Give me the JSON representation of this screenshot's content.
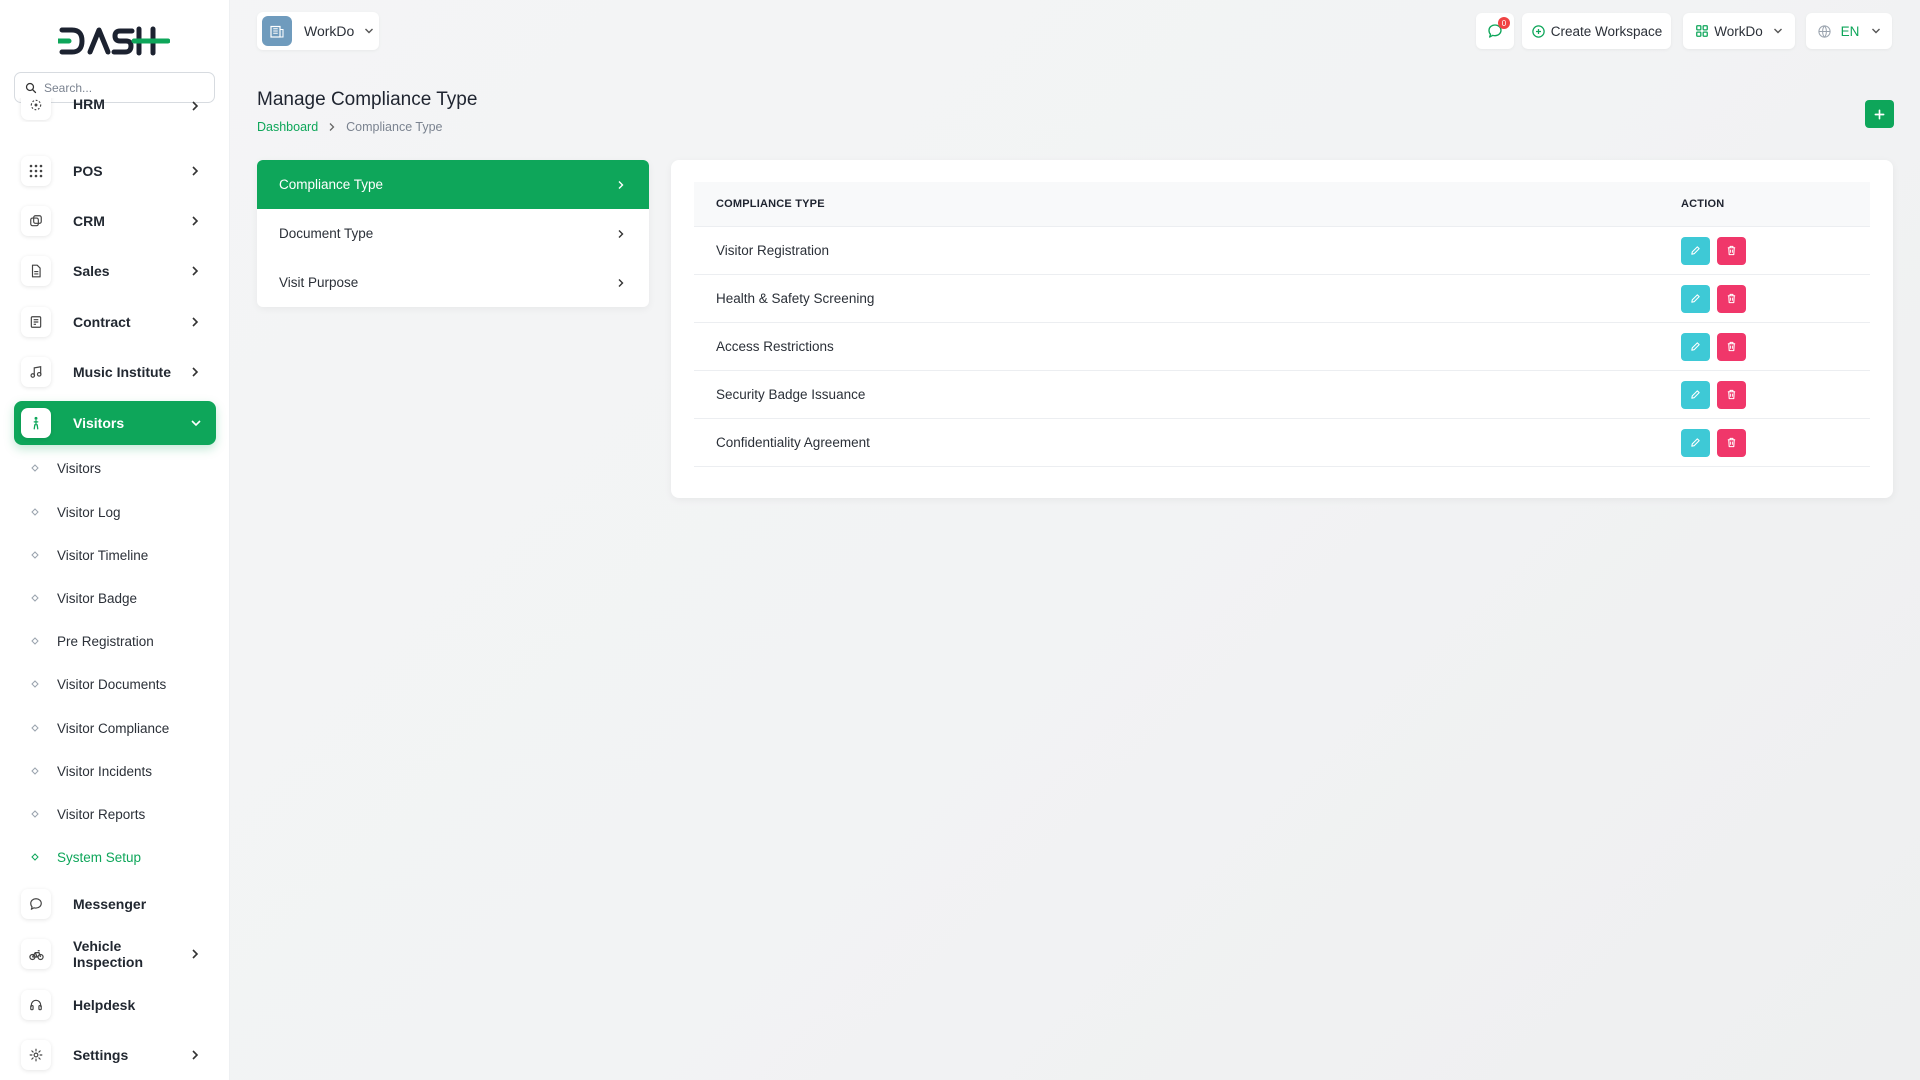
{
  "sidebar": {
    "search_placeholder": "Search...",
    "items": [
      {
        "label": "HRM",
        "icon": "hrm-icon"
      },
      {
        "label": "POS",
        "icon": "grid-icon"
      },
      {
        "label": "CRM",
        "icon": "crm-icon"
      },
      {
        "label": "Sales",
        "icon": "file-icon"
      },
      {
        "label": "Contract",
        "icon": "contract-icon"
      },
      {
        "label": "Music Institute",
        "icon": "music-icon"
      },
      {
        "label": "Visitors",
        "icon": "visitor-icon"
      },
      {
        "label": "Messenger",
        "icon": "message-icon"
      },
      {
        "label": "Vehicle Inspection",
        "icon": "bike-icon"
      },
      {
        "label": "Helpdesk",
        "icon": "headset-icon"
      },
      {
        "label": "Settings",
        "icon": "gear-icon"
      }
    ],
    "visitors_sub": [
      "Visitors",
      "Visitor Log",
      "Visitor Timeline",
      "Visitor Badge",
      "Pre Registration",
      "Visitor Documents",
      "Visitor Compliance",
      "Visitor Incidents",
      "Visitor Reports",
      "System Setup"
    ]
  },
  "topbar": {
    "workspace_name": "WorkDo",
    "notification_count": "0",
    "create_workspace_label": "Create Workspace",
    "user_workspace_label": "WorkDo",
    "language": "EN"
  },
  "page": {
    "title": "Manage Compliance Type",
    "breadcrumb_home": "Dashboard",
    "breadcrumb_current": "Compliance Type"
  },
  "setup_menu": [
    "Compliance Type",
    "Document Type",
    "Visit Purpose"
  ],
  "table": {
    "headers": {
      "type": "COMPLIANCE TYPE",
      "action": "ACTION"
    },
    "rows": [
      "Visitor Registration",
      "Health & Safety Screening",
      "Access Restrictions",
      "Security Badge Issuance",
      "Confidentiality Agreement"
    ]
  },
  "colors": {
    "accent": "#0ea65a",
    "edit": "#3ec9d6",
    "delete": "#f0376a"
  }
}
